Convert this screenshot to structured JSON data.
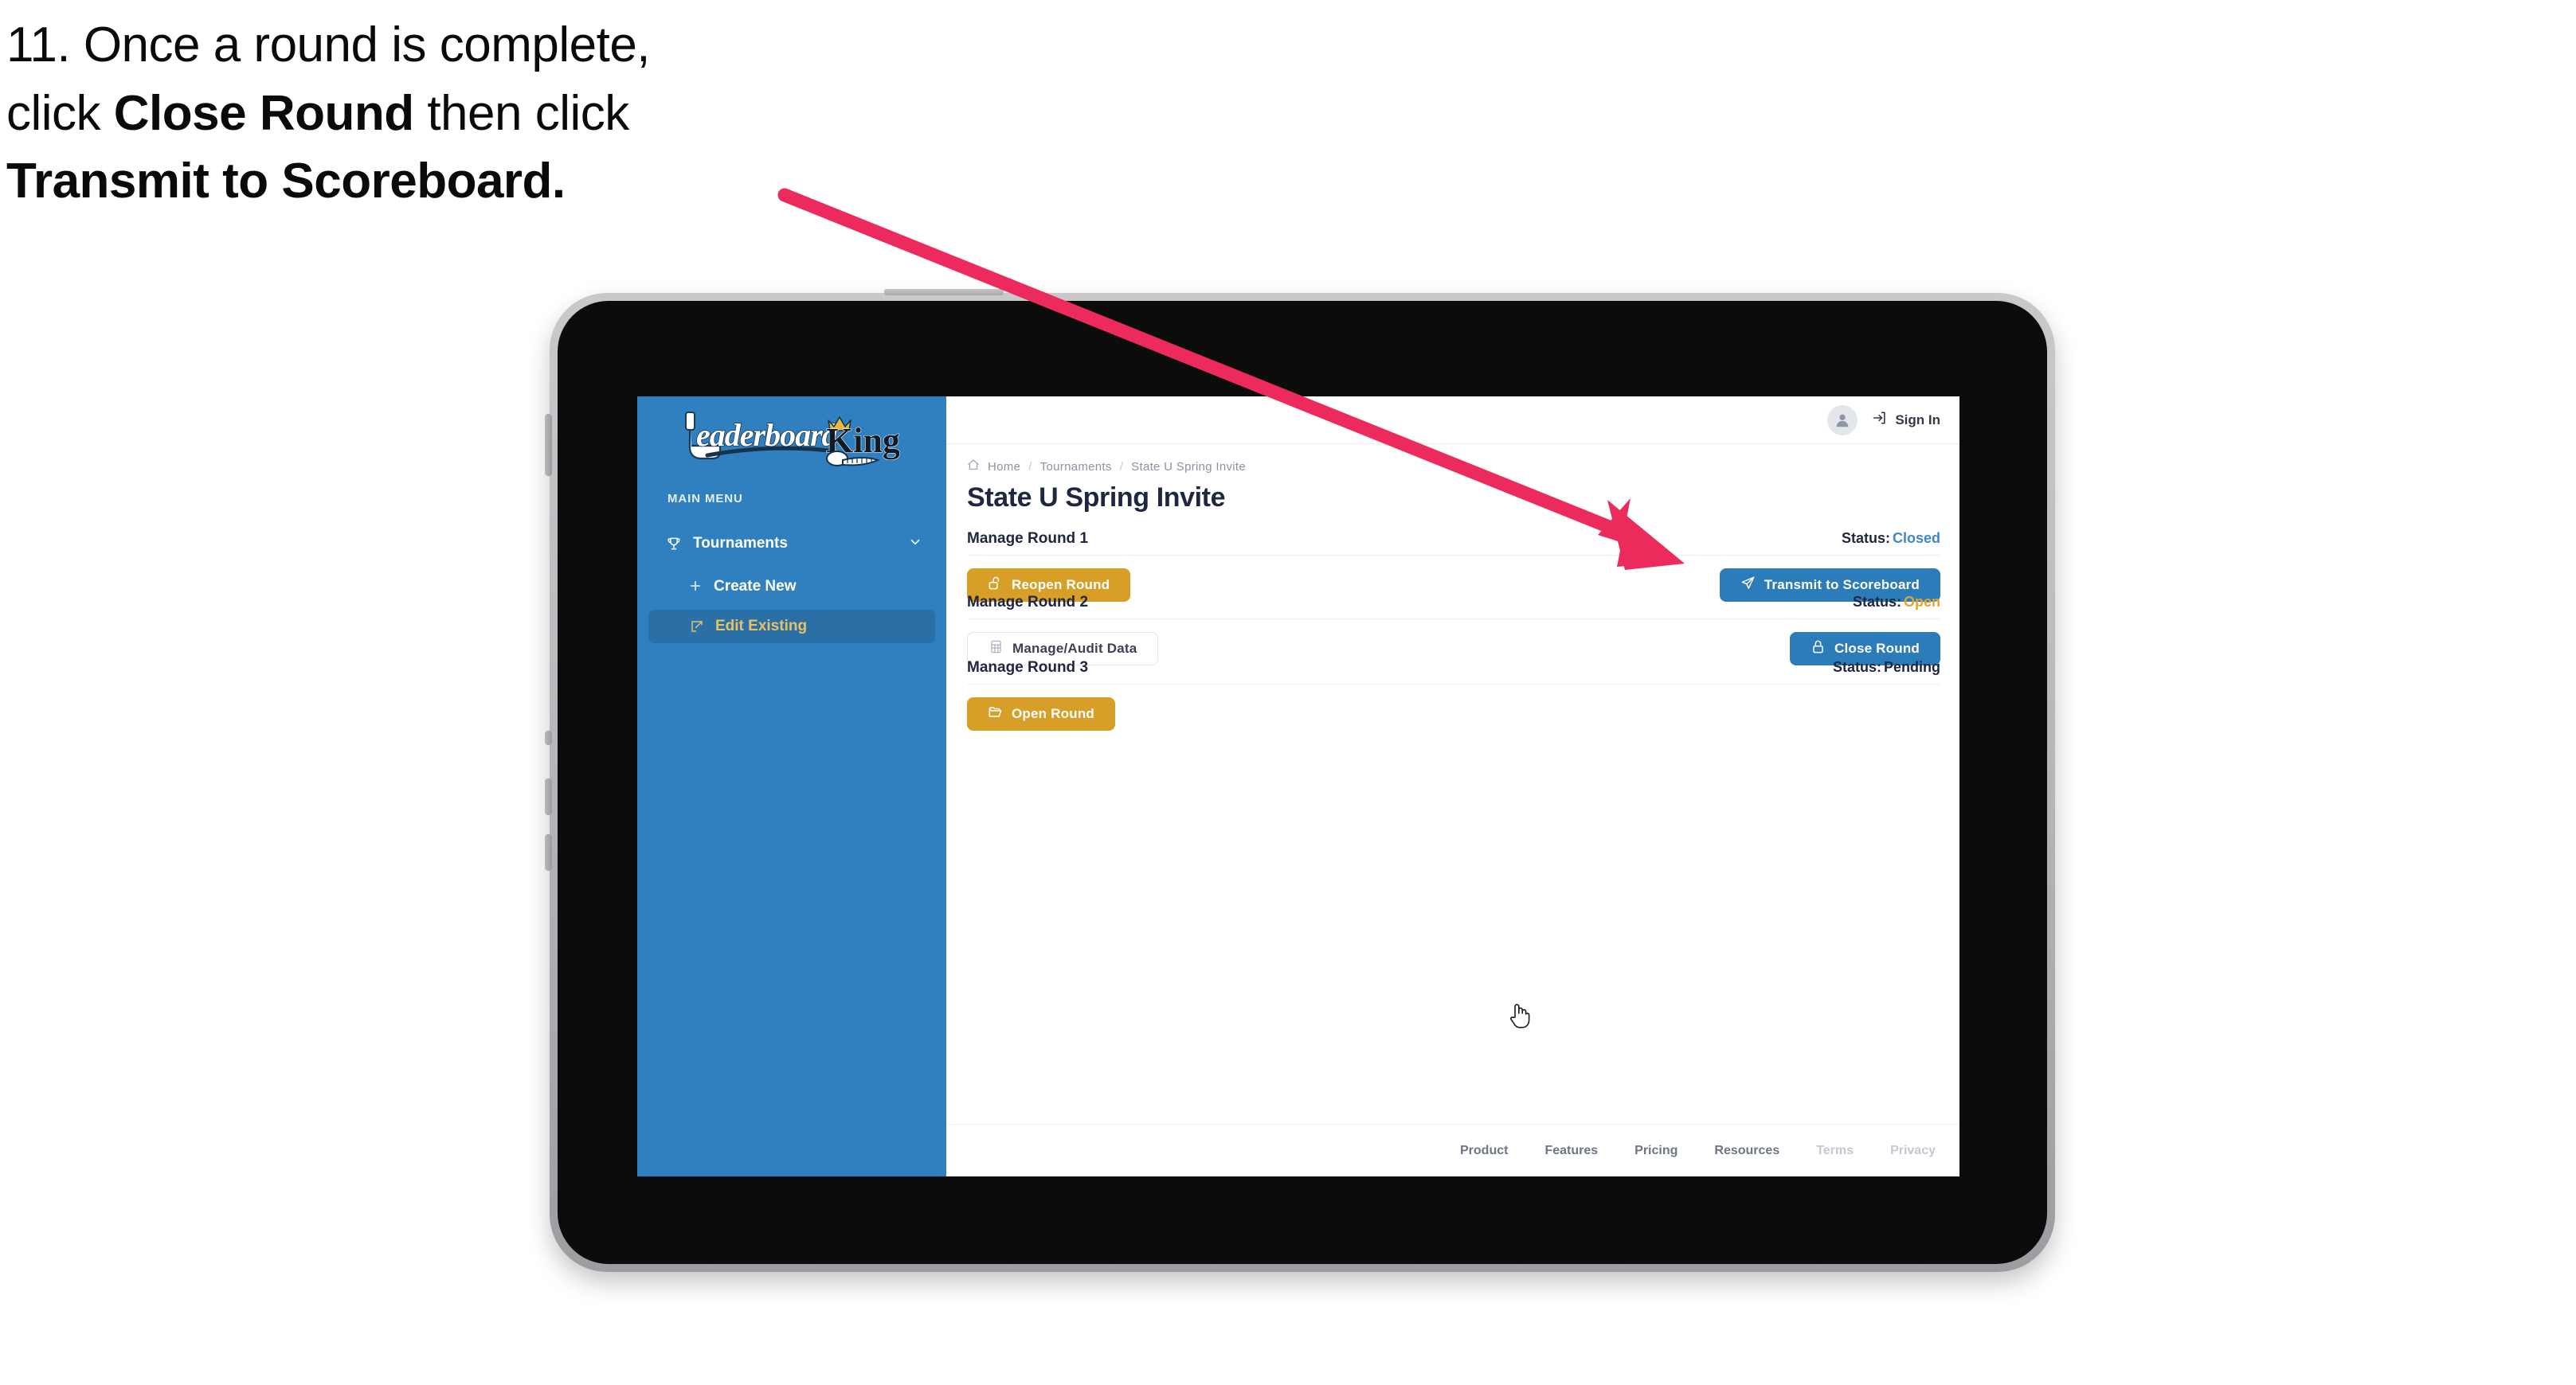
{
  "caption": {
    "line1_prefix": "11. Once a round is complete,",
    "line2_prefix": "click ",
    "line2_bold": "Close Round",
    "line2_suffix": " then click",
    "line3_bold": "Transmit to Scoreboard."
  },
  "annotation": {
    "arrow_color": "#ec2b5c",
    "arrow_points_to": "transmit-to-scoreboard-button"
  },
  "app": {
    "sidebar": {
      "logo_text": "LeaderboardKing",
      "logo_word_1": "Leaderboard",
      "logo_word_2": "King",
      "section_label": "MAIN MENU",
      "items": [
        {
          "label": "Tournaments",
          "icon": "trophy-icon",
          "expanded": true,
          "chevron": "chevron-down-icon"
        },
        {
          "label": "Create New",
          "icon": "plus-icon",
          "active": false
        },
        {
          "label": "Edit Existing",
          "icon": "edit-square-icon",
          "active": true
        }
      ],
      "background_color": "#3080c0",
      "active_item_color": "#2a6fa6",
      "active_label_color": "#e8c166"
    },
    "topbar": {
      "avatar_icon": "user-avatar-icon",
      "signin_label": "Sign In",
      "signin_icon": "login-arrow-icon"
    },
    "breadcrumb": {
      "home_icon": "home-icon",
      "items": [
        "Home",
        "Tournaments",
        "State U Spring Invite"
      ],
      "separator": "/"
    },
    "page_title": "State U Spring Invite",
    "rounds": [
      {
        "name": "Manage Round 1",
        "status_label": "Status:",
        "status_value": "Closed",
        "status_class": "val-closed",
        "left_button": {
          "label": "Reopen Round",
          "icon": "unlock-icon",
          "style": "gold"
        },
        "right_button": {
          "label": "Transmit to Scoreboard",
          "icon": "send-paper-plane-icon",
          "style": "blue"
        }
      },
      {
        "name": "Manage Round 2",
        "status_label": "Status:",
        "status_value": "Open",
        "status_class": "val-open",
        "left_button": {
          "label": "Manage/Audit Data",
          "icon": "spreadsheet-grid-icon",
          "style": "ghost"
        },
        "right_button": {
          "label": "Close Round",
          "icon": "lock-icon",
          "style": "blue"
        }
      },
      {
        "name": "Manage Round 3",
        "status_label": "Status:",
        "status_value": "Pending",
        "status_class": "val-pending",
        "left_button": {
          "label": "Open Round",
          "icon": "open-folder-icon",
          "style": "gold"
        },
        "right_button": null
      }
    ],
    "footer_links": [
      {
        "label": "Product",
        "muted": false
      },
      {
        "label": "Features",
        "muted": false
      },
      {
        "label": "Pricing",
        "muted": false
      },
      {
        "label": "Resources",
        "muted": false
      },
      {
        "label": "Terms",
        "muted": true
      },
      {
        "label": "Privacy",
        "muted": true
      }
    ],
    "cursor": {
      "type": "pointing-hand",
      "over": "edit-existing-sidebar-item"
    }
  }
}
